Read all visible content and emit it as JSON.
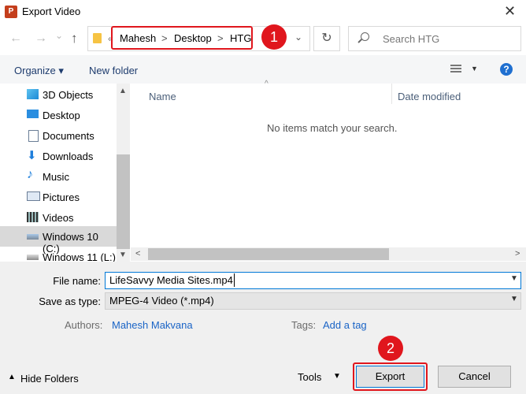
{
  "window": {
    "title": "Export Video",
    "app_icon": "powerpoint-icon",
    "close_glyph": "✕"
  },
  "nav": {
    "back_glyph": "←",
    "forward_glyph": "→",
    "recent_glyph": "⌄",
    "up_glyph": "↑",
    "more_glyph": "«",
    "breadcrumbs": [
      "Mahesh",
      "Desktop",
      "HTG"
    ],
    "separator": ">",
    "dropdown_glyph": "⌄",
    "refresh_glyph": "↻",
    "search_placeholder": "Search HTG"
  },
  "callouts": {
    "one": "1",
    "two": "2",
    "color": "#e0161d"
  },
  "toolbar": {
    "organize": "Organize ▾",
    "new_folder": "New folder",
    "view_dd": "▼",
    "help": "?"
  },
  "sidebar": {
    "items": [
      {
        "label": "3D Objects",
        "icon": "3d-objects-icon"
      },
      {
        "label": "Desktop",
        "icon": "desktop-icon"
      },
      {
        "label": "Documents",
        "icon": "documents-icon"
      },
      {
        "label": "Downloads",
        "icon": "downloads-icon"
      },
      {
        "label": "Music",
        "icon": "music-icon"
      },
      {
        "label": "Pictures",
        "icon": "pictures-icon"
      },
      {
        "label": "Videos",
        "icon": "videos-icon"
      },
      {
        "label": "Windows 10 (C:)",
        "icon": "drive-icon"
      },
      {
        "label": "Windows 11 (L:)",
        "icon": "drive-icon"
      }
    ]
  },
  "filelist": {
    "columns": [
      "Name",
      "Date modified"
    ],
    "sort_glyph": "^",
    "empty_message": "No items match your search."
  },
  "form": {
    "file_name_label": "File name:",
    "file_name_value": "LifeSavvy Media Sites.mp4",
    "save_as_label": "Save as type:",
    "save_as_value": "MPEG-4 Video (*.mp4)",
    "authors_label": "Authors:",
    "authors_value": "Mahesh Makvana",
    "tags_label": "Tags:",
    "tags_value": "Add a tag"
  },
  "footer": {
    "hide_folders": "Hide Folders",
    "tools": "Tools",
    "export": "Export",
    "cancel": "Cancel"
  },
  "colors": {
    "accent": "#0078d7",
    "link": "#1a64c6",
    "highlight": "#e0161d"
  }
}
